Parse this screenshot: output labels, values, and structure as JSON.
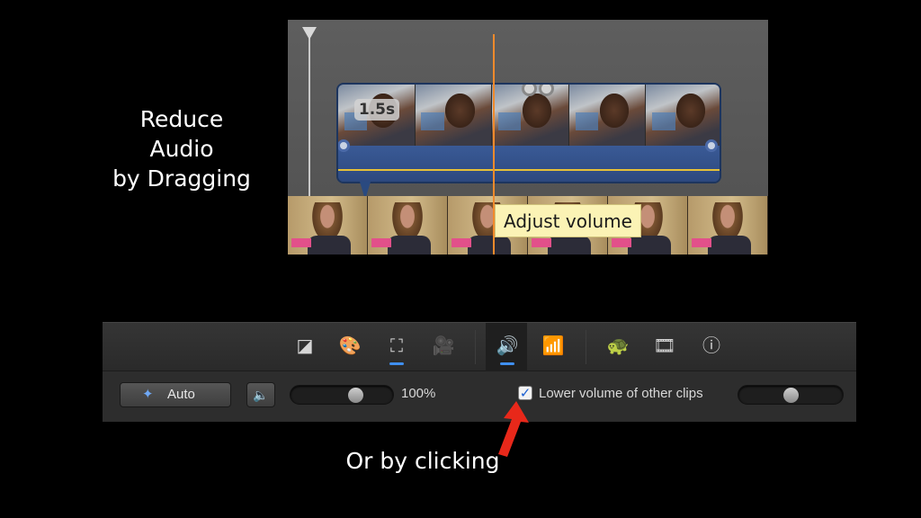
{
  "slide": {
    "caption_left": [
      "Reduce",
      "Audio",
      "by Dragging"
    ],
    "caption_bottom": "Or by clicking"
  },
  "timeline": {
    "clip_duration": "1.5s",
    "tooltip": "Adjust volume",
    "volume_line_color": "#e5c038",
    "playhead_color": "#f08a2c",
    "icons": [
      "playhead-marker-icon",
      "transition-icon",
      "volume-handle-icon"
    ]
  },
  "inspector": {
    "toolbar_icons": [
      {
        "name": "color-balance-icon",
        "glyph": "◪"
      },
      {
        "name": "color-correction-icon",
        "glyph": "🎨"
      },
      {
        "name": "crop-icon",
        "glyph": "⛶"
      },
      {
        "name": "stabilization-icon",
        "glyph": "🎥"
      },
      {
        "name": "volume-icon",
        "glyph": "🔊",
        "active": true
      },
      {
        "name": "equalizer-icon",
        "glyph": "📶"
      },
      {
        "name": "speed-icon",
        "glyph": "🐢"
      },
      {
        "name": "clip-filter-icon",
        "glyph": "🎞"
      },
      {
        "name": "info-icon",
        "glyph": "ⓘ"
      }
    ],
    "auto_label": "Auto",
    "volume_percent": "100%",
    "volume_level": 1.0,
    "lower_volume_checked": true,
    "lower_volume_label": "Lower volume of other clips",
    "other_clips_level": 0.5,
    "accent_color": "#3f8ff0"
  },
  "annotation": {
    "arrow_color": "#e8281a"
  }
}
